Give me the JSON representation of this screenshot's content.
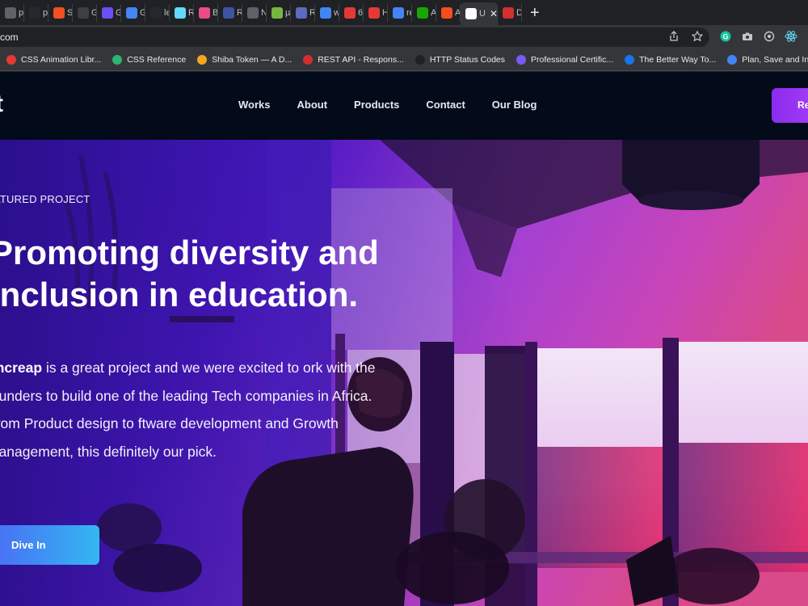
{
  "browser": {
    "tabs": [
      {
        "label": "pu",
        "icon": "page-icon",
        "color": "#5f6368"
      },
      {
        "label": "pu",
        "icon": "github-icon",
        "color": "#24292e"
      },
      {
        "label": "Si",
        "icon": "microsoft-icon",
        "color": "#f25022"
      },
      {
        "label": "Ge",
        "icon": "page-icon",
        "color": "#3c4043"
      },
      {
        "label": "Ge",
        "icon": "page-icon",
        "color": "#6e4ff6"
      },
      {
        "label": "Gc",
        "icon": "google-icon",
        "color": "#4285f4"
      },
      {
        "label": "ler",
        "icon": "github-icon",
        "color": "#24292e"
      },
      {
        "label": "Re",
        "icon": "react-icon",
        "color": "#61dafb"
      },
      {
        "label": "Br",
        "icon": "dribbble-icon",
        "color": "#ea4c89"
      },
      {
        "label": "Re",
        "icon": "frontendmentor-icon",
        "color": "#3e54a3"
      },
      {
        "label": "Ne",
        "icon": "page-icon",
        "color": "#5f6368"
      },
      {
        "label": "µT",
        "icon": "utorrent-icon",
        "color": "#76b83f"
      },
      {
        "label": "Re",
        "icon": "terminal-icon",
        "color": "#5c6bc0"
      },
      {
        "label": "wl",
        "icon": "google-icon",
        "color": "#4285f4"
      },
      {
        "label": "6 c",
        "icon": "youtube-icon",
        "color": "#e53935"
      },
      {
        "label": "He",
        "icon": "c-icon",
        "color": "#e53935"
      },
      {
        "label": "re",
        "icon": "google-icon",
        "color": "#4285f4"
      },
      {
        "label": "Ac",
        "icon": "upwork-icon",
        "color": "#14a800"
      },
      {
        "label": "Ac",
        "icon": "figma-icon",
        "color": "#f24e1e"
      },
      {
        "label": "U",
        "icon": "site-icon",
        "color": "#ffffff"
      },
      {
        "label": "Dc",
        "icon": "page-icon",
        "color": "#d32f2f"
      }
    ],
    "active_tab_index": 19,
    "url": "com",
    "bookmarks": [
      {
        "label": "CSS Animation Libr...",
        "color": "#e53935"
      },
      {
        "label": "CSS Reference",
        "color": "#2bb673"
      },
      {
        "label": "Shiba Token — A D...",
        "color": "#f5a623"
      },
      {
        "label": "REST API - Respons...",
        "color": "#d32f2f"
      },
      {
        "label": "HTTP Status Codes",
        "color": "#202124"
      },
      {
        "label": "Professional Certific...",
        "color": "#7a5af8"
      },
      {
        "label": "The Better Way To...",
        "color": "#1a73e8"
      },
      {
        "label": "Plan, Save and Inve...",
        "color": "#4285f4"
      }
    ]
  },
  "site": {
    "logo": "t",
    "nav": [
      "Works",
      "About",
      "Products",
      "Contact",
      "Our Blog"
    ],
    "cta_label": "Re",
    "hero": {
      "eyebrow": "ATURED PROJECT",
      "headline_line1": "Promoting diversity and",
      "headline_line2": "inclusion in education.",
      "body_bold": "oncreap",
      "body_rest": " is a great project and we were excited to ork with the founders to build one of the leading Tech companies in Africa. From Product design to ftware development and Growth management, this definitely our pick.",
      "button_label": "Dive In"
    }
  },
  "colors": {
    "header_bg": "#030a1a",
    "accent_purple": "#8a2cf0",
    "button_gradient_start": "#4a6ef5",
    "button_gradient_end": "#33b7f2"
  }
}
